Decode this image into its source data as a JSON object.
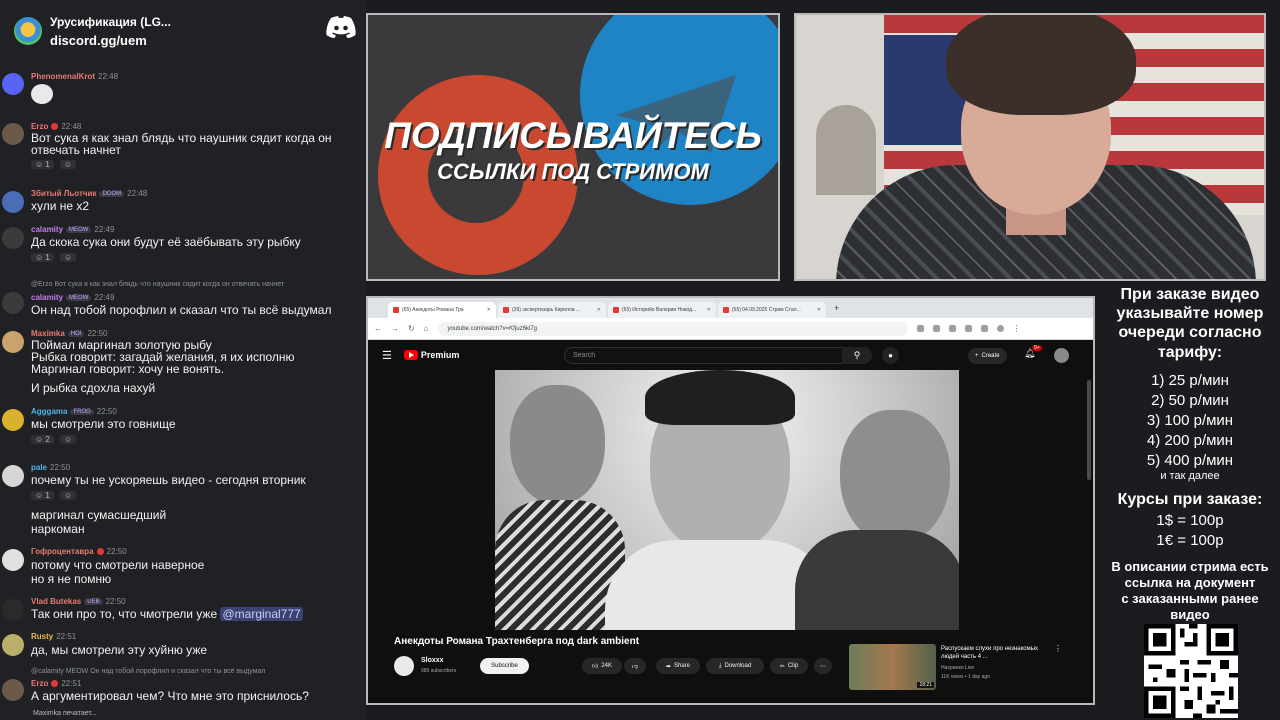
{
  "chat": {
    "header": {
      "server_name": "Урусификация (LG...",
      "server_link": "discord.gg/uem"
    },
    "messages": [
      {
        "author": "PhenomenalKrot",
        "time": "22:48",
        "text": "",
        "emote": true
      },
      {
        "author": "Erzo",
        "time": "22:48",
        "text": "Вот сука я как знал блядь что наушник сядит когда он",
        "text2": "отвечать начнет",
        "react_count": "1"
      },
      {
        "author": "Збитый Льотчик",
        "badge": "DOOM",
        "time": "22:48",
        "text": "хули не х2"
      },
      {
        "author": "calamity",
        "badge": "MEOW",
        "time": "22:49",
        "text": "Да скока сука они будут её заёбывать эту рыбку",
        "react_count": "1"
      },
      {
        "reply": "@Erzo Вот сука я как знал блядь что наушник сядит когда он отвечать начнет",
        "author": "calamity",
        "badge": "MEOW",
        "time": "22:49",
        "text": "Он над тобой порофлил и сказал что ты всё выдумал"
      },
      {
        "author": "Maximka",
        "badge": "HOI",
        "time": "22:50",
        "lines": [
          "Поймал маргинал золотую рыбу",
          "Рыбка говорит: загадай желания, я их исполню",
          "Маргинал говорит: хочу не вонять.",
          "И рыбка сдохла нахуй"
        ]
      },
      {
        "author": "Agggama",
        "badge": "FROG",
        "time": "22:50",
        "text": "мы смотрели это говнище",
        "react_count": "2"
      },
      {
        "author": "pale",
        "time": "22:50",
        "text": "почему ты не ускоряешь видео - сегодня вторник",
        "react_count": "1",
        "text3": "маргинал сумасшедший",
        "text4": "наркоман"
      },
      {
        "author": "Гофроцентавра",
        "time": "22:50",
        "text": "потому что смотрели наверное",
        "text2": "но я не помню"
      },
      {
        "author": "Vlad Butekas",
        "badge": "UEB",
        "time": "22:50",
        "text": "Так они про то, что чмотрели уже",
        "mention": "@marginal777"
      },
      {
        "author": "Rusty",
        "time": "22:51",
        "text": "да, мы смотрели эту хуйню уже"
      },
      {
        "reply": "@calamity MEOW Он над тобой порофлил и сказал что ты всё выдумал",
        "author": "Erzo",
        "time": "22:51",
        "text": "А аргументировал чем? Что мне это приснилось?"
      }
    ],
    "typing": "Maximka печатает..."
  },
  "banner": {
    "title": "ПОДПИСЫВАЙТЕСЬ",
    "subtitle": "ССЫЛКИ ПОД СТРИМОМ"
  },
  "browser": {
    "tabs": [
      {
        "label": "(65) Анекдоты Романа Тра",
        "active": true
      },
      {
        "label": "(39) экспертизарь Кирилла ...",
        "active": false
      },
      {
        "label": "(65) Историйо Валерии Новод...",
        "active": false
      },
      {
        "label": "(65) 04.09.2025 Стрим Стал...",
        "active": false
      }
    ],
    "url": "youtube.com/watch?v=Kf|uz6ki7g",
    "youtube": {
      "brand": "Premium",
      "search_placeholder": "Search",
      "create_label": "Create",
      "notifications": "9+",
      "video_title": "Анекдоты Романа Трахтенберга под dark ambient",
      "channel_name": "Sloxxx",
      "channel_subs": "989 subscribers",
      "subscribe_label": "Subscribe",
      "likes": "24K",
      "share_label": "Share",
      "download_label": "Download",
      "clip_label": "Clip",
      "recommended": {
        "title": "Распускаем слухи про незнакомых людей часть 4 ...",
        "channel": "Нахрюкко Live",
        "meta": "11K views • 1 day ago",
        "duration": "18:21"
      }
    }
  },
  "info": {
    "intro": [
      "При заказе видео",
      "указывайте номер",
      "очереди согласно",
      "тарифу:"
    ],
    "prices": [
      "1) 25 р/мин",
      "2) 50 р/мин",
      "3) 100 р/мин",
      "4) 200 р/мин",
      "5) 400 р/мин"
    ],
    "more": "и так далее",
    "rates_title": "Курсы при заказе:",
    "rates": [
      "1$ = 100р",
      "1€ = 100р"
    ],
    "note": [
      "В описании стрима есть",
      "ссылка на документ",
      "с заказанными ранее",
      "видео"
    ]
  },
  "colors": {
    "discord": "#5865f2",
    "youtube_red": "#ff0000",
    "telegram": "#1f84c6",
    "patreon": "#c8492f"
  }
}
